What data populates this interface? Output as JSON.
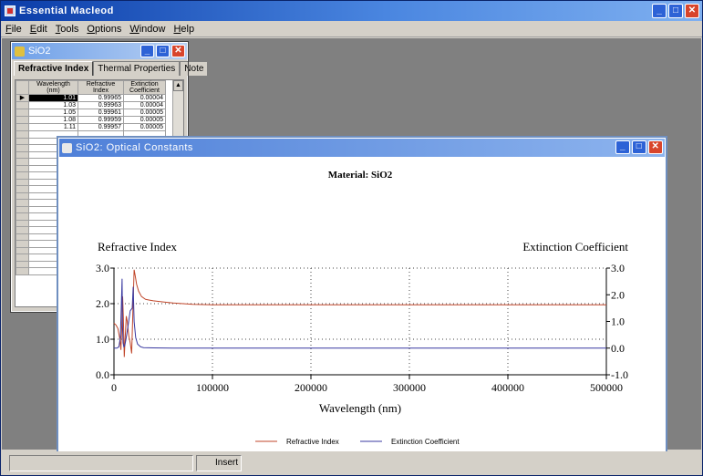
{
  "app": {
    "title": "Essential Macleod",
    "menu": [
      "File",
      "Edit",
      "Tools",
      "Options",
      "Window",
      "Help"
    ],
    "status": [
      "",
      "Insert"
    ]
  },
  "sio2_window": {
    "title": "SiO2",
    "tabs": [
      "Refractive Index",
      "Thermal Properties",
      "Note"
    ],
    "columns": [
      "Wavelength (nm)",
      "Refractive Index",
      "Extinction Coefficient"
    ],
    "rows": [
      [
        "1.01",
        "0.99965",
        "0.00004"
      ],
      [
        "1.03",
        "0.99963",
        "0.00004"
      ],
      [
        "1.05",
        "0.99961",
        "0.00005"
      ],
      [
        "1.08",
        "0.99959",
        "0.00005"
      ],
      [
        "1.11",
        "0.99957",
        "0.00005"
      ]
    ]
  },
  "optical_window": {
    "title": "SiO2: Optical Constants"
  },
  "chart_data": {
    "type": "line",
    "title": "Material: SiO2",
    "left_axis_title": "Refractive Index",
    "right_axis_title": "Extinction Coefficient",
    "xlabel": "Wavelength (nm)",
    "xlim": [
      0,
      500000
    ],
    "ylim_left": [
      0,
      3
    ],
    "ylim_right": [
      -1,
      3
    ],
    "x_ticks": [
      "0",
      "100000",
      "200000",
      "300000",
      "400000",
      "500000"
    ],
    "y_ticks_left": [
      "0.0",
      "1.0",
      "2.0",
      "3.0"
    ],
    "y_ticks_right": [
      "-1.0",
      "0.0",
      "1.0",
      "2.0",
      "3.0"
    ],
    "grid": "dotted",
    "legend_position": "bottom",
    "series": [
      {
        "name": "Refractive Index",
        "axis": "left",
        "color": "#c0462a",
        "x": [
          0,
          2000,
          4000,
          6000,
          7000,
          8000,
          8800,
          9500,
          10500,
          11500,
          12500,
          13500,
          15000,
          16500,
          18000,
          19500,
          20500,
          21500,
          23000,
          25000,
          28000,
          32000,
          36000,
          40000,
          50000,
          60000,
          70000,
          80000,
          100000,
          150000,
          200000,
          300000,
          400000,
          500000
        ],
        "y": [
          1.45,
          1.4,
          1.3,
          1.0,
          0.7,
          1.4,
          2.2,
          1.6,
          0.5,
          1.1,
          1.65,
          1.5,
          1.1,
          0.9,
          0.6,
          2.1,
          2.95,
          2.8,
          2.55,
          2.35,
          2.2,
          2.12,
          2.1,
          2.08,
          2.05,
          2.02,
          2.0,
          1.98,
          1.97,
          1.97,
          1.97,
          1.97,
          1.97,
          1.97
        ]
      },
      {
        "name": "Extinction Coefficient",
        "axis": "right",
        "color": "#3838a0",
        "x": [
          0,
          3000,
          5000,
          6500,
          7500,
          8200,
          8700,
          9300,
          10000,
          11000,
          12500,
          14500,
          16500,
          18500,
          19500,
          20500,
          22000,
          24000,
          27000,
          30000,
          40000,
          60000,
          80000,
          100000,
          200000,
          300000,
          400000,
          500000
        ],
        "y": [
          0.0,
          0.0,
          0.05,
          0.4,
          1.6,
          2.6,
          0.8,
          0.2,
          0.05,
          0.1,
          0.4,
          0.9,
          1.4,
          1.5,
          2.3,
          1.0,
          0.4,
          0.15,
          0.05,
          0.02,
          0.01,
          0.0,
          0.0,
          0.0,
          0.0,
          0.0,
          0.0,
          0.0
        ]
      }
    ]
  }
}
